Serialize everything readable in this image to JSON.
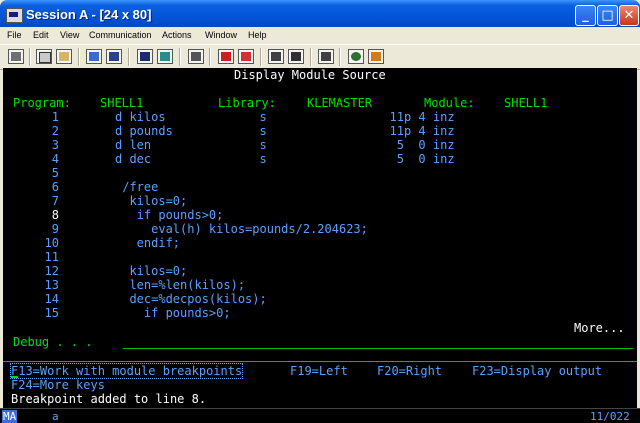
{
  "window": {
    "title": "Session A - [24 x 80]",
    "min_glyph": "_",
    "max_glyph": "□",
    "close_glyph": "✕"
  },
  "menu": {
    "items": [
      "File",
      "Edit",
      "View",
      "Communication",
      "Actions",
      "Window",
      "Help"
    ]
  },
  "toolbar": {
    "icons": [
      "print-icon",
      "copy-icon",
      "paste-icon",
      "send-icon",
      "receive-icon",
      "display-icon",
      "keypad-icon",
      "macro-icon",
      "record-icon",
      "play-icon",
      "stop-icon",
      "clipboard-icon",
      "support-icon",
      "palette-icon"
    ]
  },
  "screen": {
    "heading": "Display Module Source",
    "program_label": "Program:",
    "program_value": "SHELL1",
    "library_label": "Library:",
    "library_value": "KLEMASTER",
    "module_label": "Module:",
    "module_value": "SHELL1",
    "lines": [
      {
        "num": "1",
        "text": "d kilos             s                 11p 4 inz"
      },
      {
        "num": "2",
        "text": "d pounds            s                 11p 4 inz"
      },
      {
        "num": "3",
        "text": "d len               s                  5  0 inz"
      },
      {
        "num": "4",
        "text": "d dec               s                  5  0 inz"
      },
      {
        "num": "5",
        "text": ""
      },
      {
        "num": "6",
        "text": " /free"
      },
      {
        "num": "7",
        "text": "  kilos=0;"
      },
      {
        "num": "8",
        "text": "   if pounds>0;"
      },
      {
        "num": "9",
        "text": "     eval(h) kilos=pounds/2.204623;"
      },
      {
        "num": "10",
        "text": "   endif;"
      },
      {
        "num": "11",
        "text": ""
      },
      {
        "num": "12",
        "text": "  kilos=0;"
      },
      {
        "num": "13",
        "text": "  len=%len(kilos);"
      },
      {
        "num": "14",
        "text": "  dec=%decpos(kilos);"
      },
      {
        "num": "15",
        "text": "    if pounds>0;"
      }
    ],
    "more": "More...",
    "debug_label": "Debug . . .",
    "fkeys": {
      "f13": "F13=Work with module breakpoints",
      "f19": "F19=Left",
      "f20": "F20=Right",
      "f23": "F23=Display output",
      "f24": "F24=More keys"
    },
    "message": "Breakpoint added to line 8."
  },
  "status": {
    "ma": "MA",
    "indicator": "a",
    "position": "11/022"
  },
  "colors": {
    "text_white": "#ffffff",
    "text_green": "#00e000",
    "text_blue": "#5aa0ff",
    "title_blue": "#0453d6"
  }
}
